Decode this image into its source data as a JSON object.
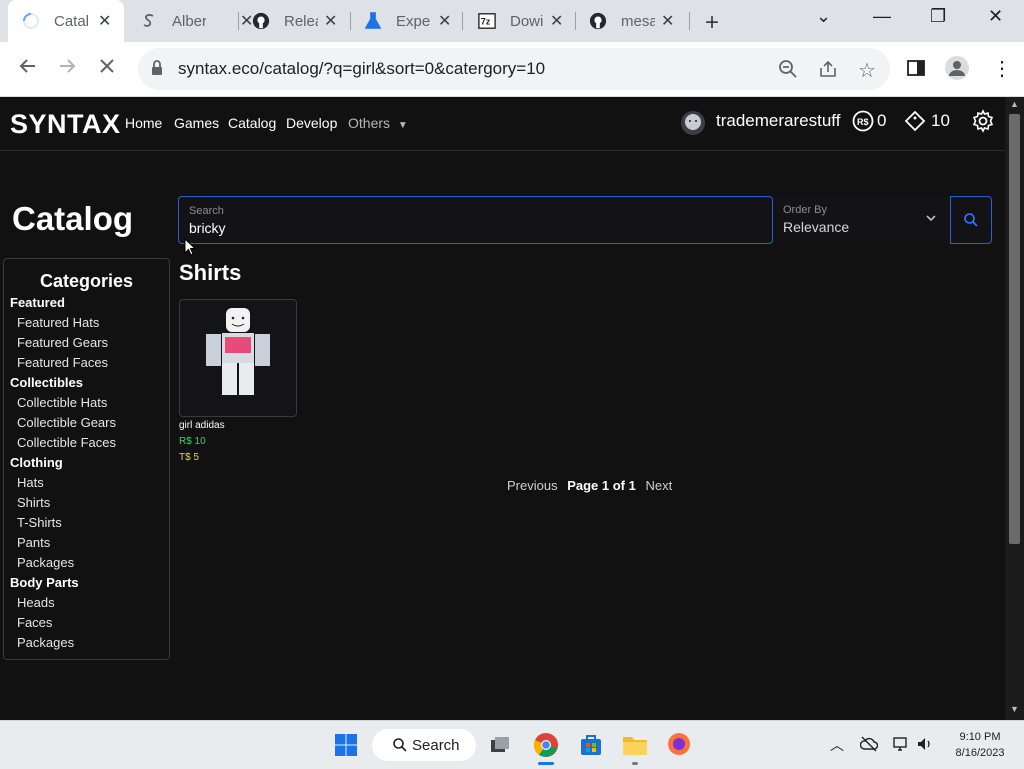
{
  "browser": {
    "tabs": [
      {
        "title": "Catal",
        "icon": "loading-icon",
        "active": true
      },
      {
        "title": "Alber",
        "icon": "s-logo-icon"
      },
      {
        "title": "Relea",
        "icon": "github-icon"
      },
      {
        "title": "Expe",
        "icon": "flask-icon"
      },
      {
        "title": "Dowi",
        "icon": "7zip-icon"
      },
      {
        "title": "mesa",
        "icon": "github-icon"
      }
    ],
    "url": "syntax.eco/catalog/?q=girl&sort=0&catergory=10"
  },
  "header": {
    "logo": "SYNTAX",
    "nav": [
      "Home",
      "Games",
      "Catalog",
      "Develop",
      "Others"
    ],
    "username": "trademerarestuff",
    "robux": "0",
    "tix": "10"
  },
  "page": {
    "title": "Catalog",
    "search": {
      "label": "Search",
      "value": "bricky"
    },
    "order": {
      "label": "Order By",
      "value": "Relevance"
    },
    "categories_heading": "Categories",
    "categories": [
      {
        "label": "Featured",
        "group": true
      },
      {
        "label": "Featured Hats"
      },
      {
        "label": "Featured Gears"
      },
      {
        "label": "Featured Faces"
      },
      {
        "label": "Collectibles",
        "group": true
      },
      {
        "label": "Collectible Hats"
      },
      {
        "label": "Collectible Gears"
      },
      {
        "label": "Collectible Faces"
      },
      {
        "label": "Clothing",
        "group": true
      },
      {
        "label": "Hats"
      },
      {
        "label": "Shirts"
      },
      {
        "label": "T-Shirts"
      },
      {
        "label": "Pants"
      },
      {
        "label": "Packages"
      },
      {
        "label": "Body Parts",
        "group": true
      },
      {
        "label": "Heads"
      },
      {
        "label": "Faces"
      },
      {
        "label": "Packages"
      }
    ],
    "section_title": "Shirts",
    "items": [
      {
        "name": "girl adidas",
        "robux_price": "R$ 10",
        "tix_price": "T$ 5"
      }
    ],
    "pagination": {
      "previous": "Previous",
      "page_text": "Page 1 of 1",
      "next": "Next"
    }
  },
  "taskbar": {
    "search_label": "Search",
    "time": "9:10 PM",
    "date": "8/16/2023"
  },
  "colors": {
    "accent": "#1e63d6",
    "robux": "#3ecf6e",
    "tix": "#e6d44a",
    "background": "#111112"
  }
}
